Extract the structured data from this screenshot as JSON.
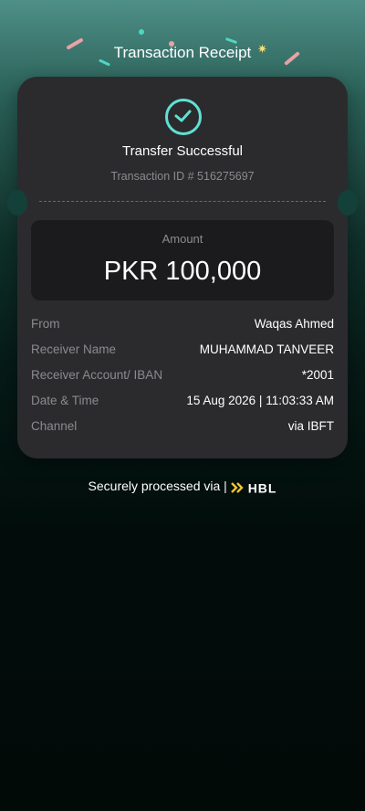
{
  "header": {
    "title": "Transaction Receipt"
  },
  "receipt": {
    "status": "Transfer Successful",
    "transaction_id": "Transaction ID # 516275697",
    "amount_label": "Amount",
    "amount_value": "PKR 100,000",
    "details": [
      {
        "label": "From",
        "value": "Waqas Ahmed"
      },
      {
        "label": "Receiver Name",
        "value": "MUHAMMAD TANVEER"
      },
      {
        "label": "Receiver Account/ IBAN",
        "value": "*2001"
      },
      {
        "label": "Date & Time",
        "value": "15 Aug 2026 | 11:03:33 AM"
      },
      {
        "label": "Channel",
        "value": "via IBFT"
      }
    ]
  },
  "footer": {
    "prefix": "Securely processed via |",
    "brand": "HBL"
  },
  "colors": {
    "accent": "#5fe1d2",
    "card": "#2b2b2e",
    "amount_box": "#1b1b1d",
    "muted_text": "#8b8b8f",
    "brand_yellow": "#f2c230"
  },
  "icons": [
    "check-circle-icon",
    "sparkle-icon",
    "hbl-logo-icon"
  ]
}
